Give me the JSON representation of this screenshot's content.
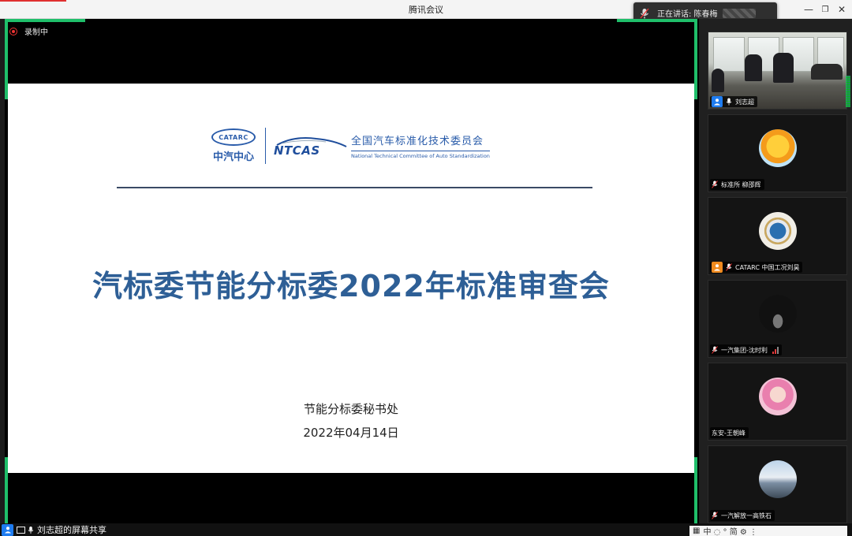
{
  "window": {
    "title": "腾讯会议"
  },
  "speaking": {
    "label": "正在讲话: 陈春梅"
  },
  "recording": {
    "label": "录制中"
  },
  "slide": {
    "catarc_logo_text": "CATARC",
    "catarc_cn": "中汽中心",
    "ntcas_logo_text": "NTCAS",
    "committee_cn": "全国汽车标准化技术委员会",
    "committee_en": "National Technical Committee of Auto Standardization",
    "title": "汽标委节能分标委2022年标准审查会",
    "org": "节能分标委秘书处",
    "date": "2022年04月14日"
  },
  "participants": [
    {
      "name": "刘志超",
      "type": "video",
      "badge": "user"
    },
    {
      "name": "标准所 柳邵辉",
      "type": "avatar"
    },
    {
      "name": "CATARC 中国工况刘昊",
      "type": "avatar",
      "badge": "user-orange"
    },
    {
      "name": "一汽集团-沈时利",
      "type": "avatar",
      "signal": true
    },
    {
      "name": "东安-王朝峰",
      "type": "avatar"
    },
    {
      "name": "一汽解放一高铁石",
      "type": "avatar"
    }
  ],
  "share_info": {
    "label": "刘志超的屏幕共享"
  },
  "ime": {
    "text": "中 ◌ ° 简 ⚙ ⋮"
  },
  "colors": {
    "accent_green": "#1fbf6a",
    "title_blue": "#2e5f96",
    "rec_red": "#e33333"
  }
}
